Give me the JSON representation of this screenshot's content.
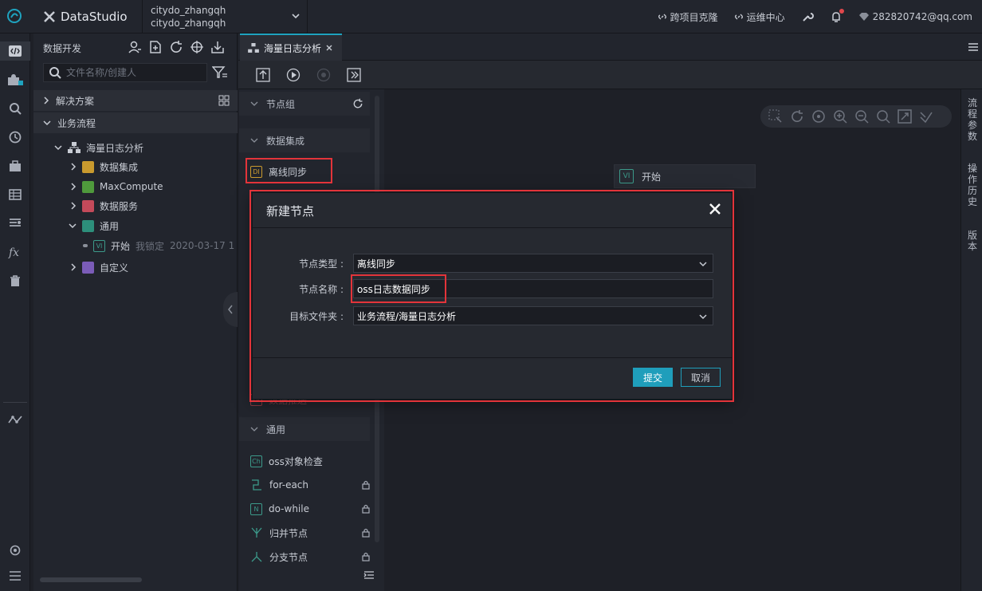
{
  "topbar": {
    "brand": "DataStudio",
    "workspace_line1": "citydo_zhangqh",
    "workspace_line2": "citydo_zhangqh",
    "clone": "跨项目克隆",
    "ops": "运维中心",
    "account": "282820742@qq.com"
  },
  "explorer": {
    "title": "数据开发",
    "search_placeholder": "文件名称/创建人",
    "section_solutions": "解决方案",
    "section_flows": "业务流程",
    "tree": {
      "flow": "海量日志分析",
      "data_integration": "数据集成",
      "maxcompute": "MaxCompute",
      "data_service": "数据服务",
      "general": "通用",
      "start_node": "开始",
      "start_lock": "我锁定",
      "start_date": "2020-03-17 1",
      "custom": "自定义"
    }
  },
  "tab": {
    "label": "海量日志分析"
  },
  "palette": {
    "group_nodes": "节点组",
    "group_integration": "数据集成",
    "offline_sync": "离线同步",
    "partial_hidden": "数据推送",
    "group_general": "通用",
    "items": {
      "oss_check": "oss对象检查",
      "for_each": "for-each",
      "do_while": "do-while",
      "merge": "归并节点",
      "branch": "分支节点"
    }
  },
  "canvas": {
    "start_node": "开始"
  },
  "right_rail": {
    "params": "流程参数",
    "history": "操作历史",
    "version": "版本"
  },
  "modal": {
    "title": "新建节点",
    "type_label": "节点类型 :",
    "type_value": "离线同步",
    "name_label": "节点名称 :",
    "name_value": "oss日志数据同步",
    "folder_label": "目标文件夹 :",
    "folder_value": "业务流程/海量日志分析",
    "submit": "提交",
    "cancel": "取消"
  }
}
